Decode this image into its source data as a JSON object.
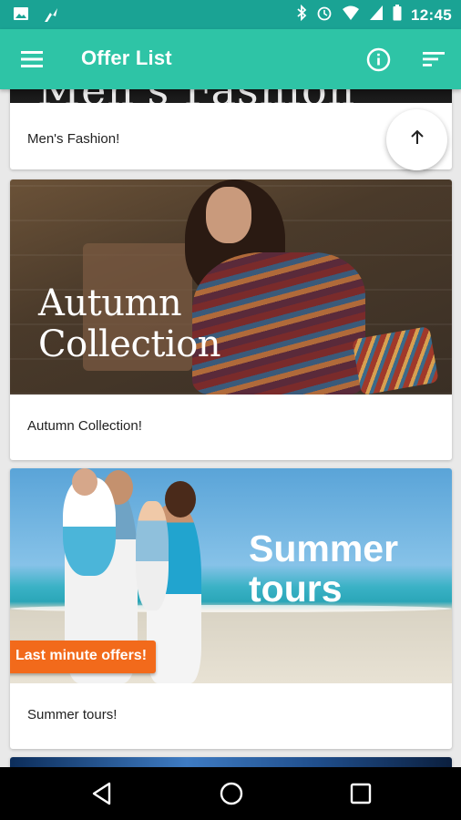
{
  "status_bar": {
    "time": "12:45",
    "icons": [
      "image-icon",
      "flag-icon",
      "bluetooth-icon",
      "alarm-icon",
      "wifi-icon",
      "signal-icon",
      "battery-icon"
    ]
  },
  "app_bar": {
    "title": "Offer List",
    "menu_icon": "menu-icon",
    "info_icon": "info-icon",
    "sort_icon": "sort-icon"
  },
  "offers": [
    {
      "image_text": "Men's Fashion",
      "caption": "Men's Fashion!"
    },
    {
      "image_text_line1": "Autumn",
      "image_text_line2": "Collection",
      "caption": "Autumn Collection!"
    },
    {
      "image_text_line1": "Summer",
      "image_text_line2": "tours",
      "badge": "Last minute offers!",
      "caption": "Summer tours!"
    }
  ],
  "fab": {
    "icon": "arrow-up-icon"
  },
  "nav_bar": {
    "icons": [
      "back-icon",
      "home-icon",
      "recents-icon"
    ]
  },
  "colors": {
    "status_bar": "#1aa394",
    "app_bar": "#2ec4a6",
    "badge": "#f26a1b",
    "background": "#e9e9e9"
  }
}
